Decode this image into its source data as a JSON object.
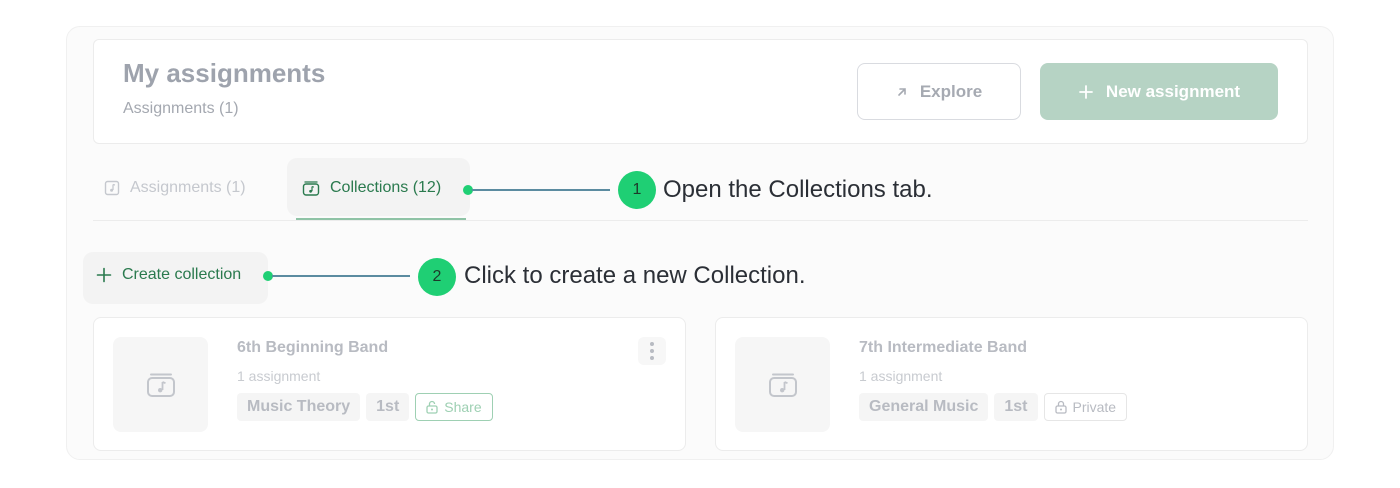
{
  "header": {
    "title": "My assignments",
    "subtitle": "Assignments (1)",
    "explore_label": "Explore",
    "new_assignment_label": "New assignment"
  },
  "tabs": [
    {
      "label": "Assignments (1)",
      "icon": "music-note-icon",
      "active": false
    },
    {
      "label": "Collections (12)",
      "icon": "collection-icon",
      "active": true
    }
  ],
  "create_collection_label": "Create collection",
  "callouts": [
    {
      "number": "1",
      "text": "Open the Collections tab."
    },
    {
      "number": "2",
      "text": "Click to create a new Collection."
    }
  ],
  "collections": [
    {
      "title": "6th Beginning Band",
      "count": "1 assignment",
      "tags": [
        "Music Theory",
        "1st"
      ],
      "visibility": "Share"
    },
    {
      "title": "7th Intermediate Band",
      "count": "1 assignment",
      "tags": [
        "General Music",
        "1st"
      ],
      "visibility": "Private"
    }
  ],
  "colors": {
    "accent_green": "#1fcf74",
    "primary_button": "#b6d3c4",
    "active_tab_text": "#2a7a4e"
  }
}
